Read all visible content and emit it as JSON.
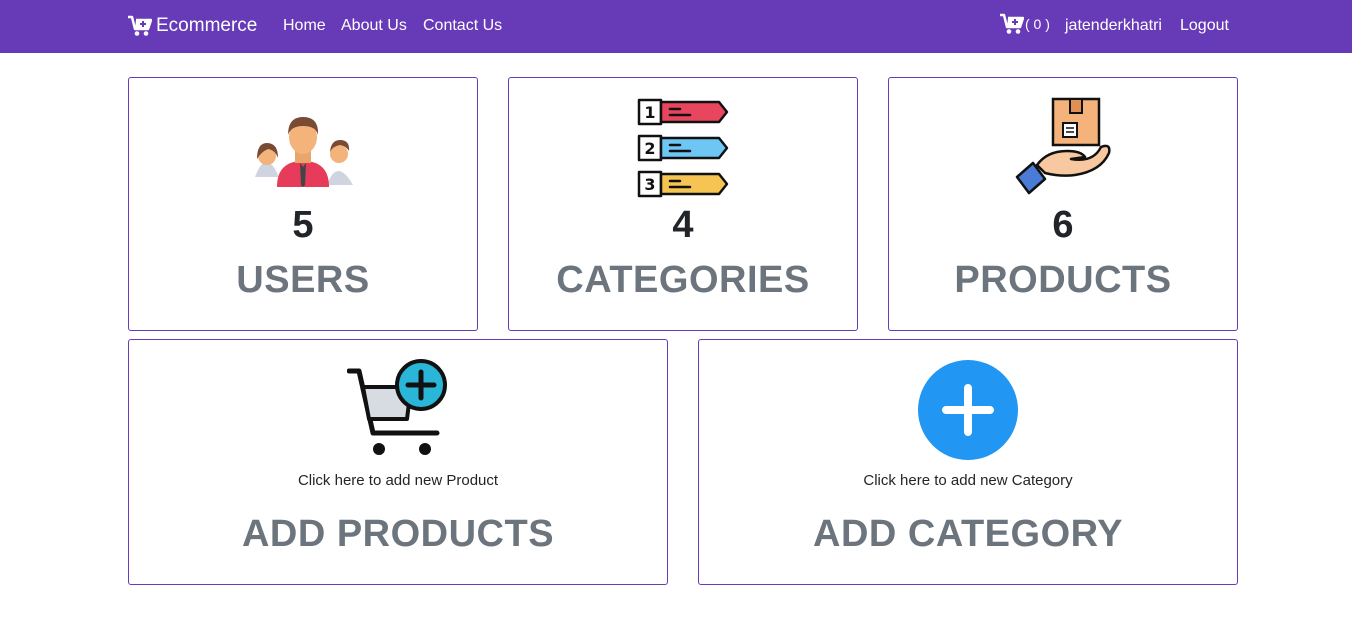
{
  "navbar": {
    "brand": "Ecommerce",
    "links": {
      "home": "Home",
      "about": "About Us",
      "contact": "Contact Us"
    },
    "cart_count": "( 0 )",
    "username": "jatenderkhatri",
    "logout": "Logout"
  },
  "stats": {
    "users": {
      "count": "5",
      "title": "USERS",
      "icon": "users-icon"
    },
    "categories": {
      "count": "4",
      "title": "CATEGORIES",
      "icon": "categories-list-icon"
    },
    "products": {
      "count": "6",
      "title": "PRODUCTS",
      "icon": "product-box-hand-icon"
    }
  },
  "actions": {
    "add_product": {
      "hint": "Click here to add new Product",
      "title": "ADD PRODUCTS",
      "icon": "cart-plus-icon"
    },
    "add_category": {
      "hint": "Click here to add new Category",
      "title": "ADD CATEGORY",
      "icon": "plus-circle-icon"
    }
  },
  "colors": {
    "accent": "#673ab7",
    "title_gray": "#6c757d",
    "plus_blue": "#2196f3"
  }
}
